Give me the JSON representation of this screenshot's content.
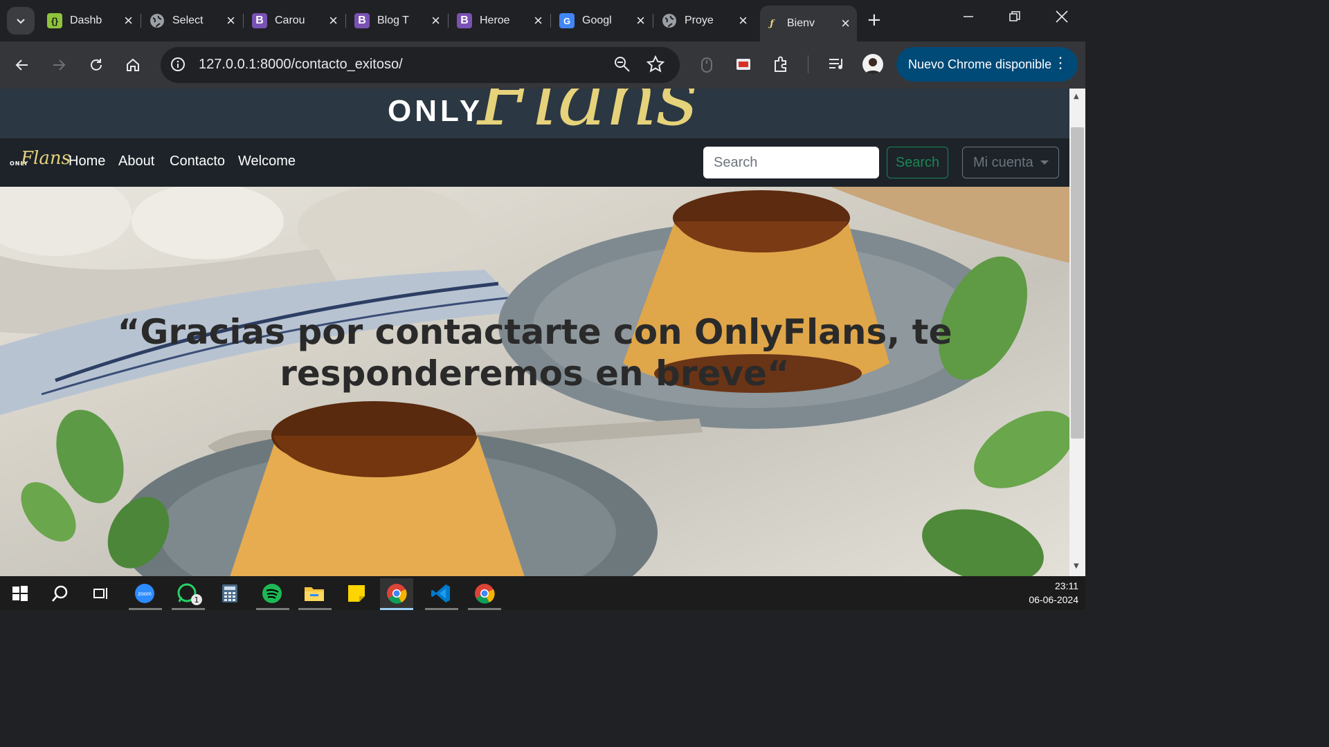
{
  "browser": {
    "tabs": [
      {
        "title": "Dashb",
        "icon": "json-favicon",
        "color": "#8ec43c",
        "glyph": "{}"
      },
      {
        "title": "Select",
        "icon": "globe-icon",
        "color": "#9aa0a6",
        "glyph": ""
      },
      {
        "title": "Carou",
        "icon": "bootstrap-icon",
        "color": "#7952b3",
        "glyph": "B"
      },
      {
        "title": "Blog T",
        "icon": "bootstrap-icon",
        "color": "#7952b3",
        "glyph": "B"
      },
      {
        "title": "Heroe",
        "icon": "bootstrap-icon",
        "color": "#7952b3",
        "glyph": "B"
      },
      {
        "title": "Googl",
        "icon": "google-translate-icon",
        "color": "#4285f4",
        "glyph": "G"
      },
      {
        "title": "Proye",
        "icon": "globe-icon",
        "color": "#9aa0a6",
        "glyph": ""
      },
      {
        "title": "Bienv",
        "icon": "onlyflans-favicon",
        "color": "#35363a",
        "glyph": "",
        "active": true
      }
    ],
    "url": "127.0.0.1:8000/contacto_exitoso/",
    "update_button": "Nuevo Chrome disponible"
  },
  "site": {
    "logo_only": "ONLY",
    "logo_flans": "Flans",
    "brand_small_only": "ONLY",
    "brand_small_flans": "Flans",
    "nav": [
      "Home",
      "About",
      "Contacto",
      "Welcome"
    ],
    "search_placeholder": "Search",
    "search_button": "Search",
    "account_button": "Mi cuenta",
    "message": "“Gracias por contactarte con OnlyFlans, te responderemos en breve“"
  },
  "taskbar": {
    "time": "23:11",
    "date": "06-06-2024",
    "whatsapp_badge": "1"
  },
  "colors": {
    "accent_green": "#198754",
    "logo_gold": "#e6d27a",
    "header_bg": "#2b3742",
    "navbar_bg": "#1d2329"
  }
}
